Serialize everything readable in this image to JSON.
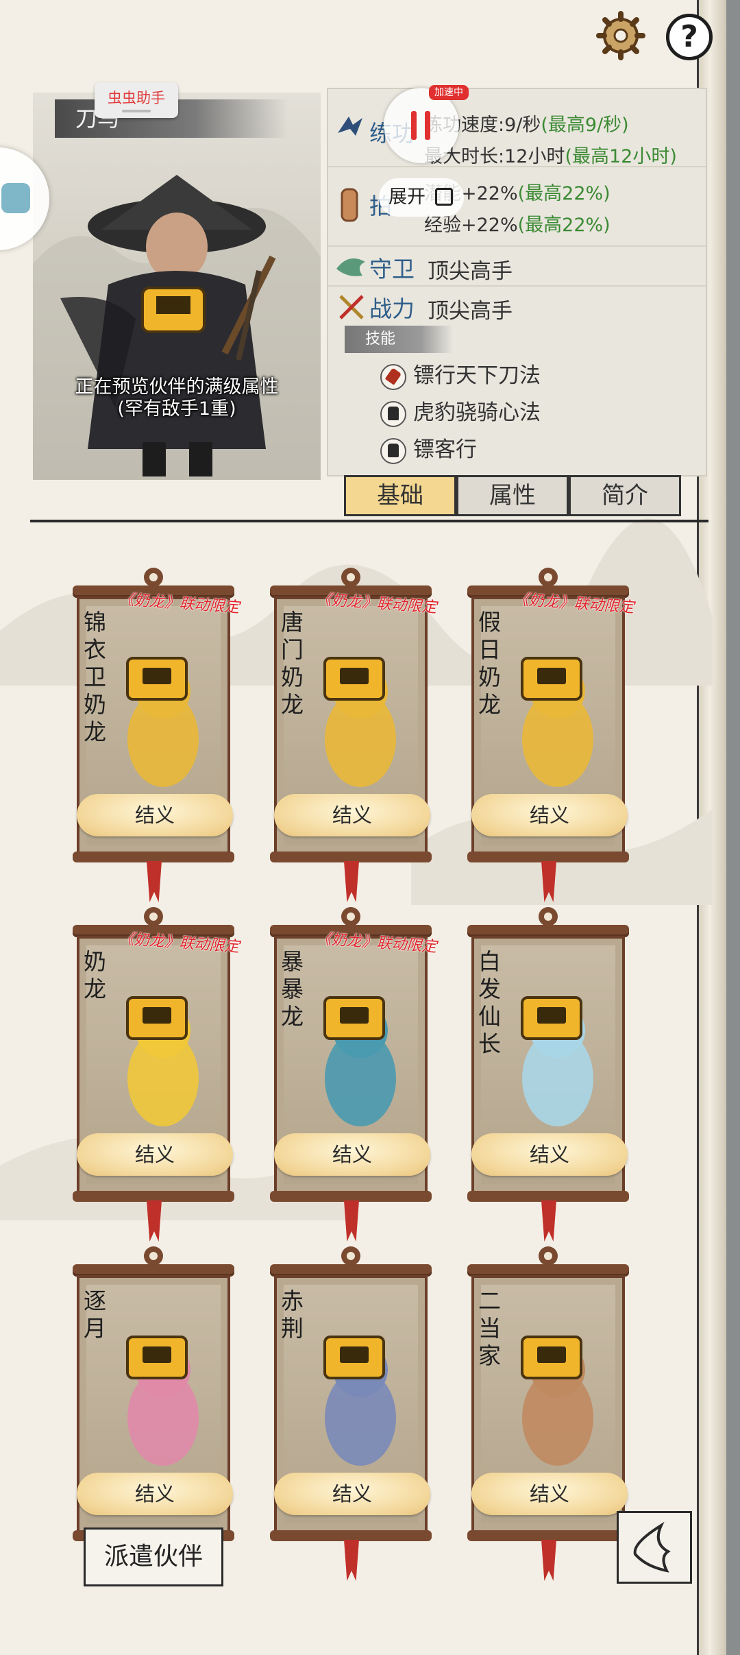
{
  "helper_tag": "虫虫助手",
  "speed_tag": "加速中",
  "expand_label": "展开",
  "partner": {
    "name": "刀马",
    "preview_note_line1": "正在预览伙伴的满级属性",
    "preview_note_line2": "(罕有敌手1重)"
  },
  "stats": {
    "practice_label": "练功",
    "practice_speed": "练功速度:9/秒",
    "practice_speed_max": "(最高9/秒)",
    "max_time": "最大时长:12小时",
    "max_time_max": "(最高12小时)",
    "fist_label": "拍",
    "potential": "潜能+22%",
    "potential_max": "(最高22%)",
    "exp": "经验+22%",
    "exp_max": "(最高22%)",
    "guard_label": "守卫",
    "guard_value": "顶尖高手",
    "power_label": "战力",
    "power_value": "顶尖高手"
  },
  "skills": {
    "header": "技能",
    "items": [
      "镖行天下刀法",
      "虎豹骁骑心法",
      "镖客行"
    ]
  },
  "tabs": [
    "基础",
    "属性",
    "简介"
  ],
  "cards": [
    {
      "name": "锦衣卫奶龙",
      "limited": "《奶龙》联动限定",
      "button": "结义"
    },
    {
      "name": "唐门奶龙",
      "limited": "《奶龙》联动限定",
      "button": "结义"
    },
    {
      "name": "假日奶龙",
      "limited": "《奶龙》联动限定",
      "button": "结义"
    },
    {
      "name": "奶龙",
      "limited": "《奶龙》联动限定",
      "button": "结义"
    },
    {
      "name": "暴暴龙",
      "limited": "《奶龙》联动限定",
      "button": "结义"
    },
    {
      "name": "白发仙长",
      "limited": "",
      "button": "结义"
    },
    {
      "name": "逐月",
      "limited": "",
      "button": "结义"
    },
    {
      "name": "赤荆",
      "limited": "",
      "button": "结义"
    },
    {
      "name": "二当家",
      "limited": "",
      "button": "结义"
    }
  ],
  "dispatch_label": "派遣伙伴",
  "colors": {
    "accent_green": "#3b8a33",
    "limited_red": "#e0242a",
    "tab_active": "#f4d891"
  }
}
